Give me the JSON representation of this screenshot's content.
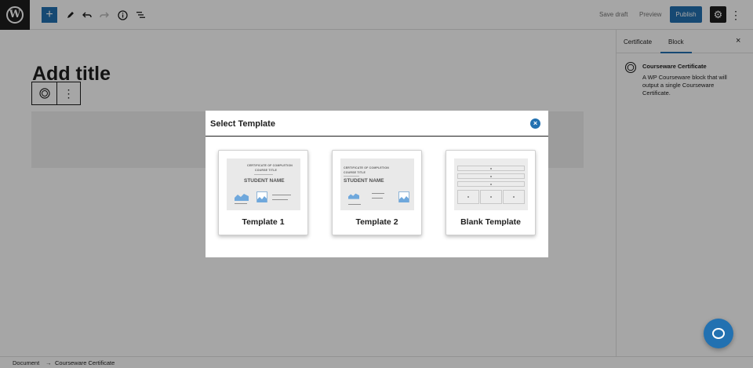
{
  "toolbar": {
    "logo_glyph": "W",
    "inserter_glyph": "+",
    "save_draft_label": "Save draft",
    "preview_label": "Preview",
    "publish_label": "Publish",
    "settings_glyph": "⚙",
    "more_glyph": "⋮"
  },
  "editor": {
    "title_placeholder": "Add title",
    "more_glyph": "⋮"
  },
  "sidebar": {
    "tabs": [
      {
        "label": "Certificate"
      },
      {
        "label": "Block",
        "active": true
      }
    ],
    "close_glyph": "×",
    "block_title": "Courseware Certificate",
    "block_description": "A WP Courseware block that will output a single Courseware Certificate."
  },
  "footer": {
    "breadcrumb": [
      "Document",
      "→",
      "Courseware Certificate"
    ]
  },
  "modal": {
    "title": "Select Template",
    "close_glyph": "×",
    "templates": [
      {
        "label": "Template 1",
        "preview_heading": "CERTIFICATE OF COMPLETION",
        "preview_course": "COURSE TITLE",
        "preview_student": "STUDENT NAME"
      },
      {
        "label": "Template 2",
        "preview_heading": "CERTIFICATE OF COMPLETION",
        "preview_course": "COURSE TITLE",
        "preview_student": "STUDENT NAME"
      },
      {
        "label": "Blank Template"
      }
    ]
  },
  "colors": {
    "accent": "#2271b1",
    "overlay": "rgba(0,0,0,0.35)",
    "dark": "#1e1e1e"
  },
  "icons": [
    "wordpress-logo-icon",
    "pencil-icon",
    "undo-icon",
    "redo-icon",
    "info-icon",
    "list-view-icon",
    "gear-icon",
    "certificate-icon",
    "close-icon",
    "help-chat-icon"
  ]
}
